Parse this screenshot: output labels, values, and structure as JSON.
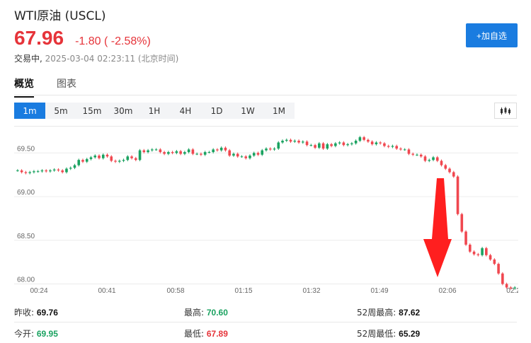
{
  "header": {
    "title": "WTI原油 (USCL)",
    "price": "67.96",
    "change": "-1.80 ( -2.58%)",
    "status": "交易中,",
    "timestamp": "2025-03-04 02:23:11 (北京时间)",
    "add_button": "+加自选"
  },
  "tabs": [
    "概览",
    "图表"
  ],
  "ranges": [
    "1m",
    "5m",
    "15m",
    "30m",
    "1H",
    "4H",
    "1D",
    "1W",
    "1M"
  ],
  "active_range": "1m",
  "colors": {
    "up": "#1aa260",
    "down": "#f0474f",
    "accent": "#1a7ce0",
    "arrow": "#ff1f1f"
  },
  "stats": [
    [
      {
        "label": "昨收:",
        "value": "69.76",
        "color": "#111"
      },
      {
        "label": "最高:",
        "value": "70.60",
        "color": "#1aa260"
      },
      {
        "label": "52周最高:",
        "value": "87.62",
        "color": "#111"
      }
    ],
    [
      {
        "label": "今开:",
        "value": "69.95",
        "color": "#1aa260"
      },
      {
        "label": "最低:",
        "value": "67.89",
        "color": "#e6343a"
      },
      {
        "label": "52周最低:",
        "value": "65.29",
        "color": "#111"
      }
    ]
  ],
  "chart_data": {
    "type": "candlestick",
    "y_ticks": [
      "69.50",
      "69.00",
      "68.50",
      "68.00"
    ],
    "x_ticks": [
      "00:24",
      "00:41",
      "00:58",
      "01:15",
      "01:32",
      "01:49",
      "02:06",
      "02:2"
    ],
    "ylim": [
      67.98,
      69.81
    ],
    "close": [
      69.3,
      69.28,
      69.27,
      69.28,
      69.29,
      69.29,
      69.3,
      69.29,
      69.3,
      69.31,
      69.3,
      69.28,
      69.32,
      69.33,
      69.36,
      69.42,
      69.4,
      69.43,
      69.45,
      69.47,
      69.44,
      69.48,
      69.46,
      69.41,
      69.4,
      69.41,
      69.42,
      69.46,
      69.44,
      69.42,
      69.53,
      69.51,
      69.53,
      69.54,
      69.54,
      69.51,
      69.49,
      69.51,
      69.5,
      69.52,
      69.49,
      69.51,
      69.54,
      69.49,
      69.49,
      69.48,
      69.51,
      69.51,
      69.54,
      69.53,
      69.56,
      69.53,
      69.47,
      69.49,
      69.46,
      69.46,
      69.44,
      69.47,
      69.5,
      69.48,
      69.53,
      69.55,
      69.54,
      69.55,
      69.62,
      69.64,
      69.65,
      69.63,
      69.64,
      69.62,
      69.63,
      69.59,
      69.59,
      69.56,
      69.61,
      69.55,
      69.6,
      69.58,
      69.61,
      69.62,
      69.59,
      69.6,
      69.61,
      69.64,
      69.68,
      69.65,
      69.63,
      69.6,
      69.62,
      69.61,
      69.58,
      69.57,
      69.58,
      69.55,
      69.54,
      69.54,
      69.49,
      69.48,
      69.48,
      69.46,
      69.41,
      69.42,
      69.45,
      69.41,
      69.36,
      69.32,
      69.28,
      69.23,
      68.8,
      68.6,
      68.45,
      68.37,
      68.34,
      68.33,
      68.41,
      68.33,
      68.28,
      68.23,
      68.12,
      68.0,
      67.96,
      67.95,
      67.96
    ]
  }
}
